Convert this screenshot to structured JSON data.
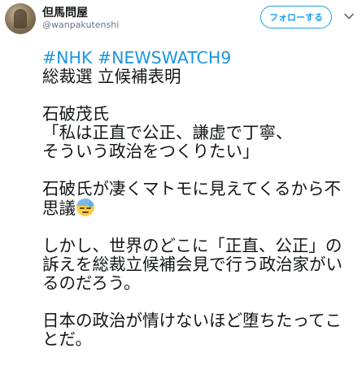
{
  "tweet": {
    "display_name": "但馬問屋",
    "screen_name": "@wanpakutenshi",
    "follow_label": "フォローする",
    "hashtag1": "#NHK",
    "hashtag2": "#NEWSWATCH9",
    "lines": [
      "総裁選 立候補表明",
      "石破茂氏",
      "「私は正直で公正、謙虚で丁寧、",
      "そういう政治をつくりたい」",
      "石破氏が凄くマトモに見えてくるから不",
      "思議",
      "しかし、世界のどこに「正直、公正」の",
      "訴えを総裁立候補会見で行う政治家がい",
      "るのだろう。",
      "日本の政治が情けないほど堕ちたってこ",
      "とだ。"
    ],
    "emoji": "sweat-face-emoji",
    "colors": {
      "link": "#1b95e0",
      "follow": "#1da1f2",
      "text": "#14171a",
      "muted": "#657786"
    }
  }
}
